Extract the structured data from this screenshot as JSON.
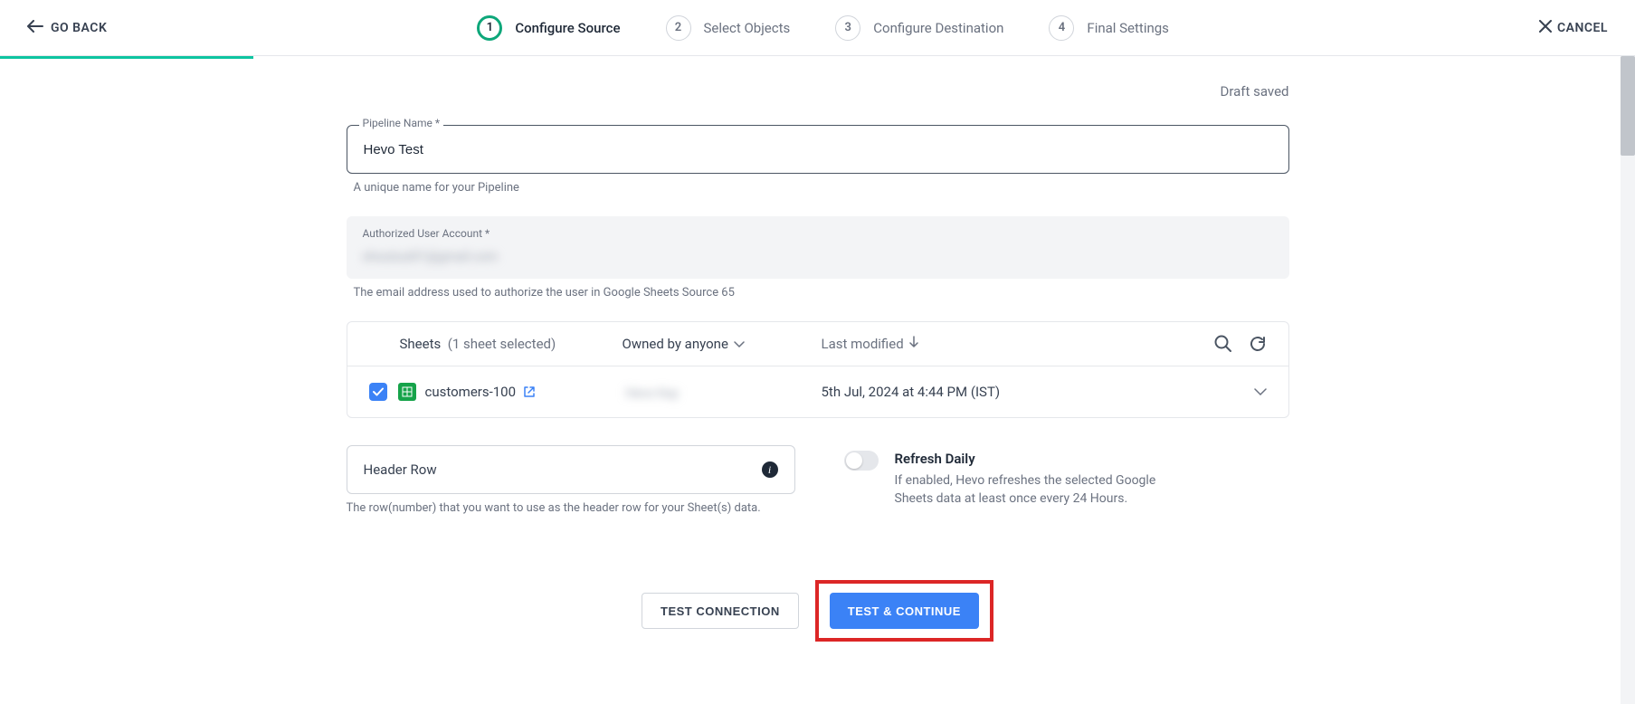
{
  "topbar": {
    "go_back": "GO BACK",
    "cancel": "CANCEL"
  },
  "steps": [
    {
      "num": "1",
      "label": "Configure Source",
      "active": true
    },
    {
      "num": "2",
      "label": "Select Objects",
      "active": false
    },
    {
      "num": "3",
      "label": "Configure Destination",
      "active": false
    },
    {
      "num": "4",
      "label": "Final Settings",
      "active": false
    }
  ],
  "draft_saved": "Draft saved",
  "pipeline": {
    "label": "Pipeline Name *",
    "value": "Hevo Test",
    "helper": "A unique name for your Pipeline"
  },
  "account": {
    "label": "Authorized User Account *",
    "value": "shoutout01@gmail.com",
    "helper": "The email address used to authorize the user in Google Sheets Source 65"
  },
  "sheets": {
    "title": "Sheets",
    "selected": "(1 sheet selected)",
    "owner_filter": "Owned by anyone",
    "sort": "Last modified",
    "rows": [
      {
        "name": "customers-100",
        "owner": "Hevo Kay",
        "modified": "5th Jul, 2024 at 4:44 PM (IST)",
        "checked": true
      }
    ]
  },
  "header_row": {
    "label": "Header Row",
    "helper": "The row(number) that you want to use as the header row for your Sheet(s) data."
  },
  "refresh": {
    "title": "Refresh Daily",
    "desc": "If enabled, Hevo refreshes the selected Google Sheets data at least once every 24 Hours."
  },
  "buttons": {
    "test_connection": "TEST CONNECTION",
    "test_continue": "TEST & CONTINUE"
  }
}
